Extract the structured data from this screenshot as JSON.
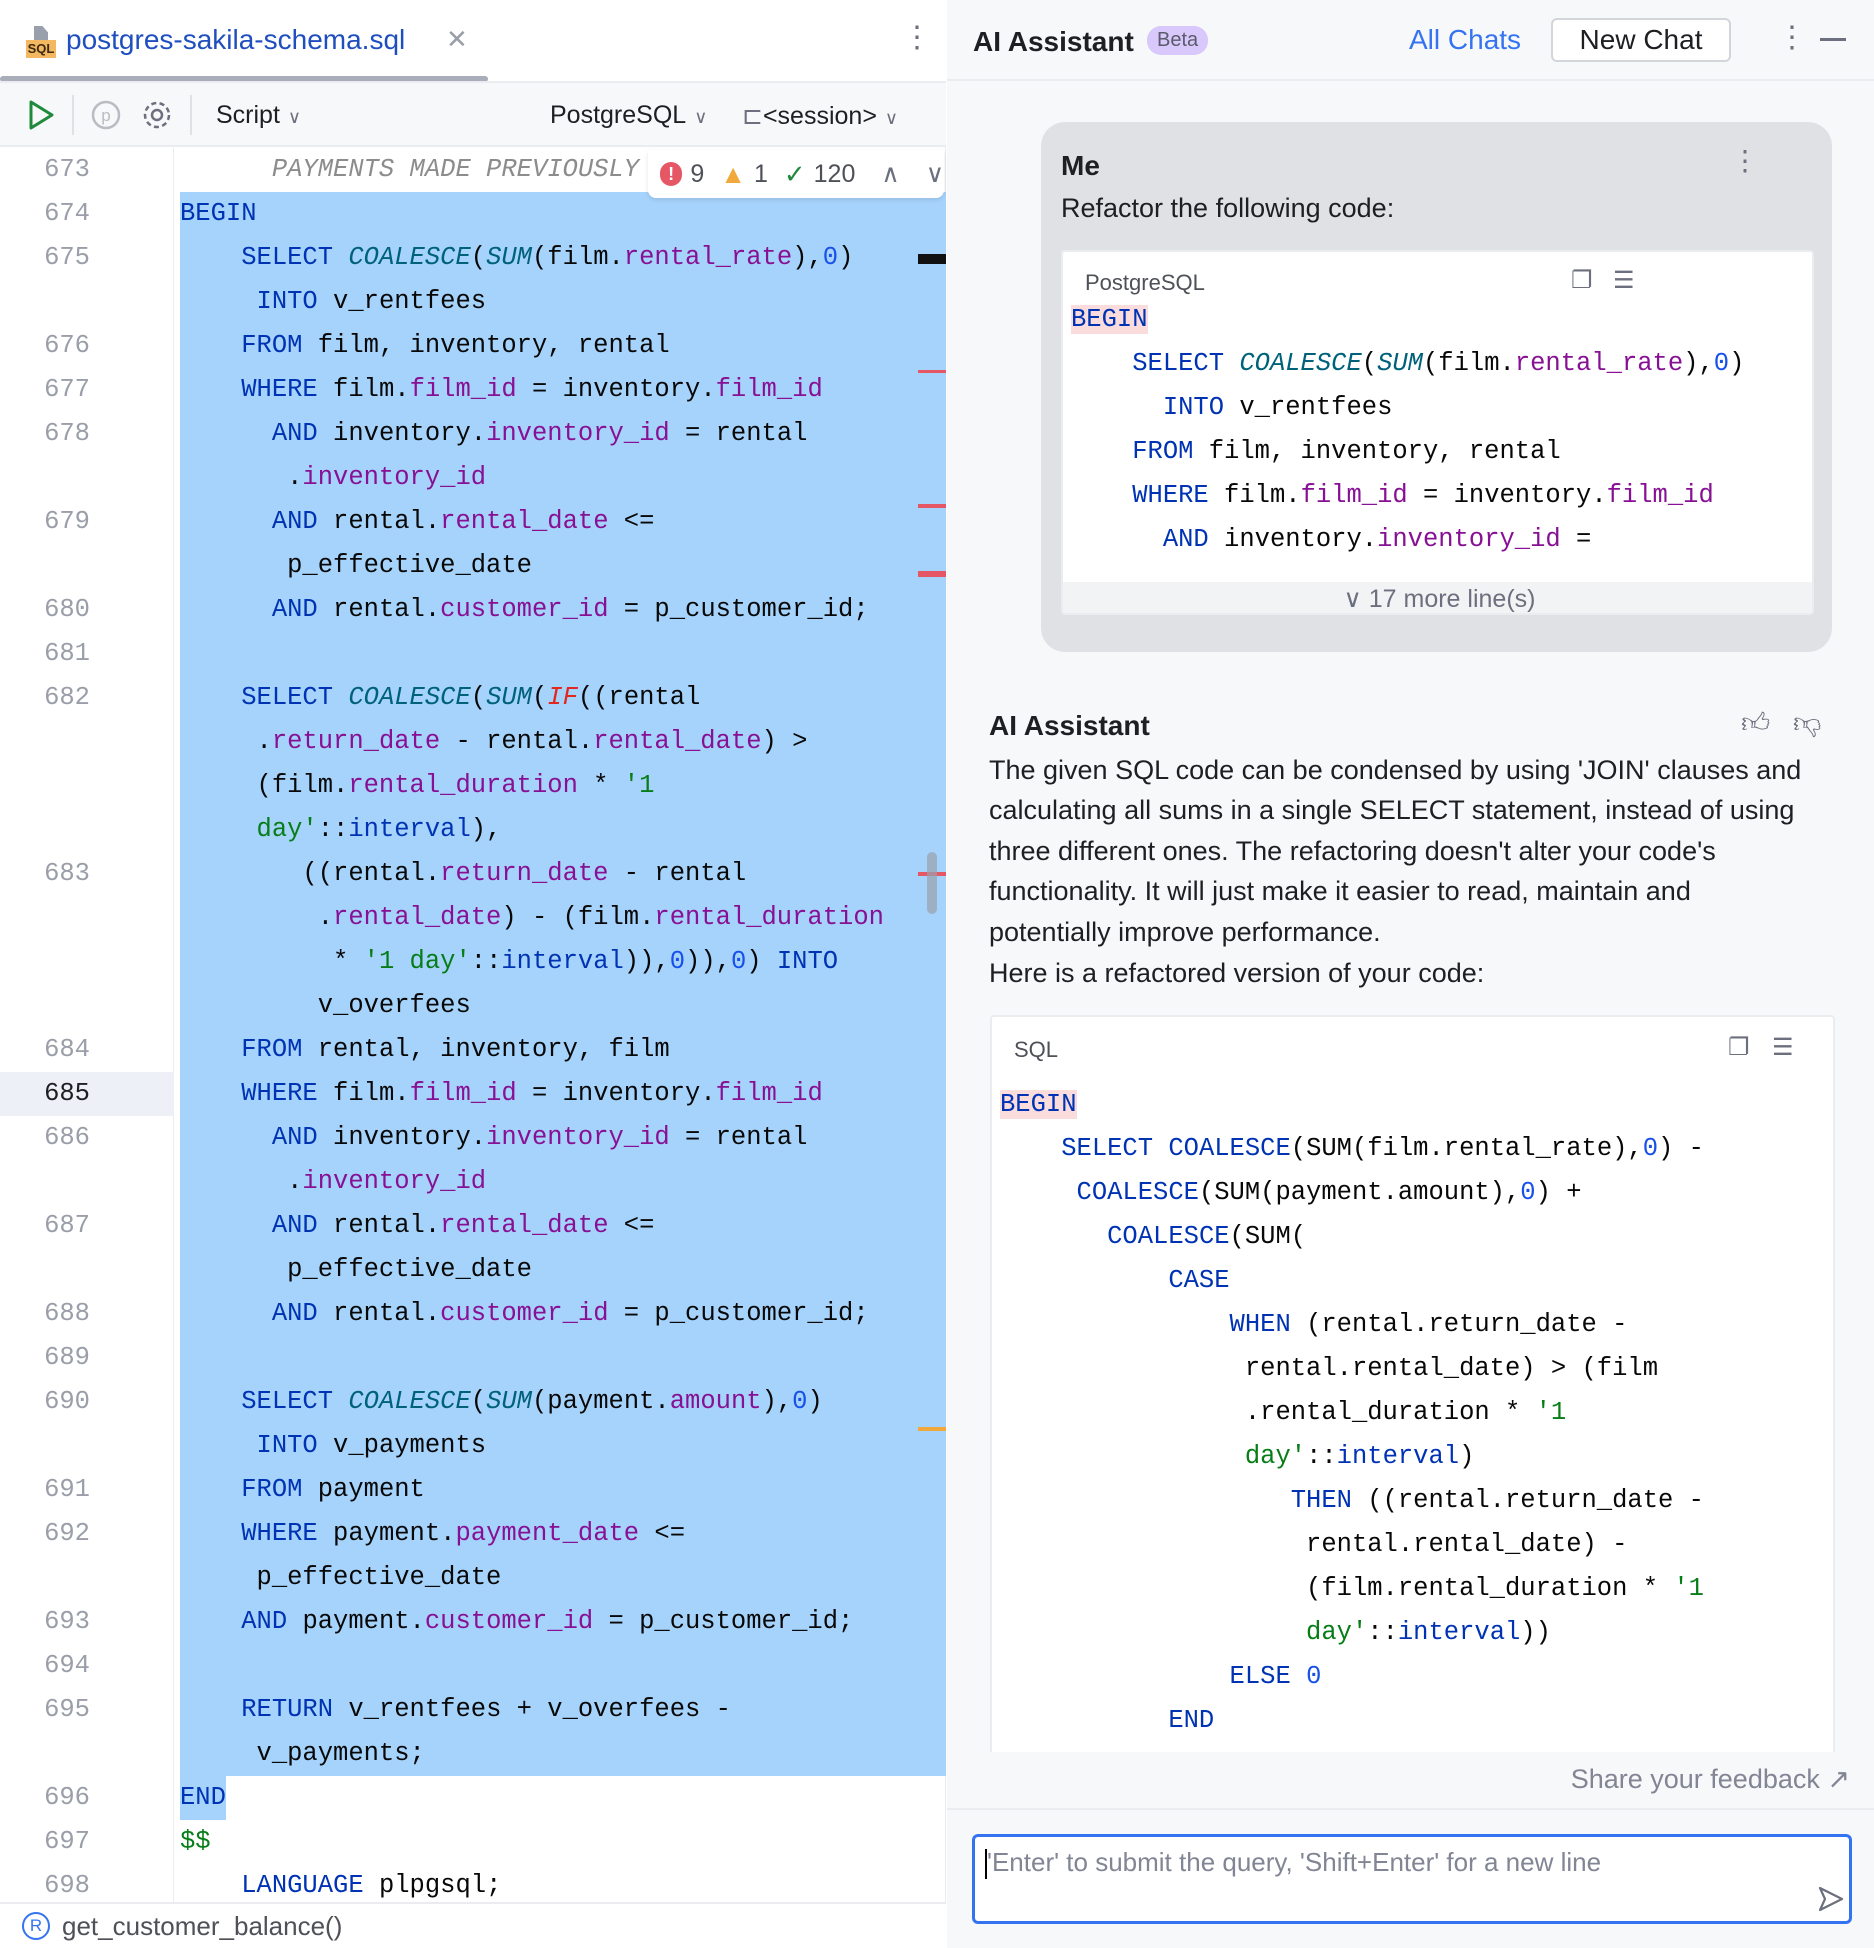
{
  "editor": {
    "tab_title": "postgres-sakila-schema.sql",
    "file_icon_text": "SQL",
    "toolbar": {
      "script_label": "Script",
      "dialect_label": "PostgreSQL",
      "session_label": "<session>"
    },
    "inspections": {
      "errors": "9",
      "warnings": "1",
      "ok": "120"
    },
    "status_function": "get_customer_balance()",
    "current_line": "685",
    "rows": [
      {
        "n": "673",
        "t": [
          [
            "c",
            "      PAYMENTS MADE PREVIOUSLY"
          ]
        ]
      },
      {
        "n": "674",
        "sel": "full",
        "t": [
          [
            "k",
            "BEGIN"
          ]
        ]
      },
      {
        "n": "675",
        "sel": "full",
        "t": [
          [
            "p",
            "    "
          ],
          [
            "k",
            "SELECT "
          ],
          [
            "f",
            "COALESCE"
          ],
          [
            "p",
            "("
          ],
          [
            "f",
            "SUM"
          ],
          [
            "p",
            "(film."
          ],
          [
            "d",
            "rental_rate"
          ],
          [
            "p",
            "),"
          ],
          [
            "n",
            "0"
          ],
          [
            "p",
            ")"
          ]
        ]
      },
      {
        "n": "",
        "sel": "full",
        "t": [
          [
            "p",
            "     "
          ],
          [
            "k",
            "INTO "
          ],
          [
            "p",
            "v_rentfees"
          ]
        ]
      },
      {
        "n": "676",
        "sel": "full",
        "t": [
          [
            "p",
            "    "
          ],
          [
            "k",
            "FROM "
          ],
          [
            "p",
            "film, inventory, rental"
          ]
        ]
      },
      {
        "n": "677",
        "sel": "full",
        "t": [
          [
            "p",
            "    "
          ],
          [
            "k",
            "WHERE "
          ],
          [
            "p",
            "film."
          ],
          [
            "d",
            "film_id"
          ],
          [
            "p",
            " = inventory."
          ],
          [
            "d",
            "film_id"
          ]
        ]
      },
      {
        "n": "678",
        "sel": "full",
        "t": [
          [
            "p",
            "      "
          ],
          [
            "k",
            "AND "
          ],
          [
            "p",
            "inventory."
          ],
          [
            "d",
            "inventory_id"
          ],
          [
            "p",
            " = rental"
          ]
        ]
      },
      {
        "n": "",
        "sel": "full",
        "t": [
          [
            "p",
            "       ."
          ],
          [
            "d",
            "inventory_id"
          ]
        ]
      },
      {
        "n": "679",
        "sel": "full",
        "t": [
          [
            "p",
            "      "
          ],
          [
            "k",
            "AND "
          ],
          [
            "p",
            "rental."
          ],
          [
            "d",
            "rental_date"
          ],
          [
            "p",
            " <="
          ]
        ]
      },
      {
        "n": "",
        "sel": "full",
        "t": [
          [
            "p",
            "       p_effective_date"
          ]
        ]
      },
      {
        "n": "680",
        "sel": "full",
        "t": [
          [
            "p",
            "      "
          ],
          [
            "k",
            "AND "
          ],
          [
            "p",
            "rental."
          ],
          [
            "d",
            "customer_id"
          ],
          [
            "p",
            " = p_customer_id;"
          ]
        ]
      },
      {
        "n": "681",
        "sel": "full",
        "t": []
      },
      {
        "n": "682",
        "sel": "full",
        "t": [
          [
            "p",
            "    "
          ],
          [
            "k",
            "SELECT "
          ],
          [
            "f",
            "COALESCE"
          ],
          [
            "p",
            "("
          ],
          [
            "f",
            "SUM"
          ],
          [
            "p",
            "("
          ],
          [
            "e",
            "IF"
          ],
          [
            "p",
            "((rental"
          ]
        ]
      },
      {
        "n": "",
        "sel": "full",
        "t": [
          [
            "p",
            "     ."
          ],
          [
            "d",
            "return_date"
          ],
          [
            "p",
            " - rental."
          ],
          [
            "d",
            "rental_date"
          ],
          [
            "p",
            ") >"
          ]
        ]
      },
      {
        "n": "",
        "sel": "full",
        "t": [
          [
            "p",
            "     (film."
          ],
          [
            "d",
            "rental_duration"
          ],
          [
            "p",
            " * "
          ],
          [
            "s",
            "'1"
          ]
        ]
      },
      {
        "n": "",
        "sel": "full",
        "t": [
          [
            "s",
            "     day'"
          ],
          [
            "p",
            "::"
          ],
          [
            "k",
            "interval"
          ],
          [
            "p",
            "),"
          ]
        ]
      },
      {
        "n": "683",
        "sel": "full",
        "t": [
          [
            "p",
            "        ((rental."
          ],
          [
            "d",
            "return_date"
          ],
          [
            "p",
            " - rental"
          ]
        ]
      },
      {
        "n": "",
        "sel": "full",
        "t": [
          [
            "p",
            "         ."
          ],
          [
            "d",
            "rental_date"
          ],
          [
            "p",
            ") - (film."
          ],
          [
            "d",
            "rental_duration"
          ]
        ]
      },
      {
        "n": "",
        "sel": "full",
        "t": [
          [
            "p",
            "          * "
          ],
          [
            "s",
            "'1 day'"
          ],
          [
            "p",
            "::"
          ],
          [
            "k",
            "interval"
          ],
          [
            "p",
            ")),"
          ],
          [
            "n",
            "0"
          ],
          [
            "p",
            ")),"
          ],
          [
            "n",
            "0"
          ],
          [
            "p",
            ") "
          ],
          [
            "k",
            "INTO"
          ]
        ]
      },
      {
        "n": "",
        "sel": "full",
        "t": [
          [
            "p",
            "         v_overfees"
          ]
        ]
      },
      {
        "n": "684",
        "sel": "full",
        "t": [
          [
            "p",
            "    "
          ],
          [
            "k",
            "FROM "
          ],
          [
            "p",
            "rental, inventory, film"
          ]
        ]
      },
      {
        "n": "685",
        "sel": "full",
        "t": [
          [
            "p",
            "    "
          ],
          [
            "k",
            "WHERE "
          ],
          [
            "p",
            "film."
          ],
          [
            "d",
            "film_id"
          ],
          [
            "p",
            " = inventory."
          ],
          [
            "d",
            "film_id"
          ]
        ]
      },
      {
        "n": "686",
        "sel": "full",
        "t": [
          [
            "p",
            "      "
          ],
          [
            "k",
            "AND "
          ],
          [
            "p",
            "inventory."
          ],
          [
            "d",
            "inventory_id"
          ],
          [
            "p",
            " = rental"
          ]
        ]
      },
      {
        "n": "",
        "sel": "full",
        "t": [
          [
            "p",
            "       ."
          ],
          [
            "d",
            "inventory_id"
          ]
        ]
      },
      {
        "n": "687",
        "sel": "full",
        "t": [
          [
            "p",
            "      "
          ],
          [
            "k",
            "AND "
          ],
          [
            "p",
            "rental."
          ],
          [
            "d",
            "rental_date"
          ],
          [
            "p",
            " <="
          ]
        ]
      },
      {
        "n": "",
        "sel": "full",
        "t": [
          [
            "p",
            "       p_effective_date"
          ]
        ]
      },
      {
        "n": "688",
        "sel": "full",
        "t": [
          [
            "p",
            "      "
          ],
          [
            "k",
            "AND "
          ],
          [
            "p",
            "rental."
          ],
          [
            "d",
            "customer_id"
          ],
          [
            "p",
            " = p_customer_id;"
          ]
        ]
      },
      {
        "n": "689",
        "sel": "full",
        "t": []
      },
      {
        "n": "690",
        "sel": "full",
        "t": [
          [
            "p",
            "    "
          ],
          [
            "k",
            "SELECT "
          ],
          [
            "f",
            "COALESCE"
          ],
          [
            "p",
            "("
          ],
          [
            "f",
            "SUM"
          ],
          [
            "p",
            "(payment."
          ],
          [
            "d",
            "amount"
          ],
          [
            "p",
            "),"
          ],
          [
            "n",
            "0"
          ],
          [
            "p",
            ")"
          ]
        ]
      },
      {
        "n": "",
        "sel": "full",
        "t": [
          [
            "p",
            "     "
          ],
          [
            "k",
            "INTO "
          ],
          [
            "p",
            "v_payments"
          ]
        ]
      },
      {
        "n": "691",
        "sel": "full",
        "t": [
          [
            "p",
            "    "
          ],
          [
            "k",
            "FROM "
          ],
          [
            "p",
            "payment"
          ]
        ]
      },
      {
        "n": "692",
        "sel": "full",
        "t": [
          [
            "p",
            "    "
          ],
          [
            "k",
            "WHERE "
          ],
          [
            "p",
            "payment."
          ],
          [
            "d",
            "payment_date"
          ],
          [
            "p",
            " <="
          ]
        ]
      },
      {
        "n": "",
        "sel": "full",
        "t": [
          [
            "p",
            "     p_effective_date"
          ]
        ]
      },
      {
        "n": "693",
        "sel": "full",
        "t": [
          [
            "p",
            "    "
          ],
          [
            "k",
            "AND "
          ],
          [
            "p",
            "payment."
          ],
          [
            "d",
            "customer_id"
          ],
          [
            "p",
            " = p_customer_id;"
          ]
        ]
      },
      {
        "n": "694",
        "sel": "full",
        "t": []
      },
      {
        "n": "695",
        "sel": "full",
        "t": [
          [
            "p",
            "    "
          ],
          [
            "k",
            "RETURN "
          ],
          [
            "p",
            "v_rentfees + v_overfees -"
          ]
        ]
      },
      {
        "n": "",
        "sel": "full",
        "t": [
          [
            "p",
            "     v_payments;"
          ]
        ]
      },
      {
        "n": "696",
        "sel": "part",
        "t": [
          [
            "k",
            "END"
          ]
        ]
      },
      {
        "n": "697",
        "t": [
          [
            "s",
            "$$"
          ]
        ]
      },
      {
        "n": "698",
        "t": [
          [
            "p",
            "    "
          ],
          [
            "k",
            "LANGUAGE "
          ],
          [
            "p",
            "plpgsql;"
          ]
        ]
      }
    ]
  },
  "assistant": {
    "title": "AI Assistant",
    "badge": "Beta",
    "all_chats": "All Chats",
    "new_chat": "New Chat",
    "user": {
      "name": "Me",
      "message": "Refactor the following code:",
      "code_lang": "PostgreSQL",
      "more_lines": "17 more line(s)",
      "rows": [
        [
          [
            "pk",
            "BEGIN"
          ]
        ],
        [
          [
            "p",
            "    "
          ],
          [
            "k",
            "SELECT "
          ],
          [
            "f",
            "COALESCE"
          ],
          [
            "p",
            "("
          ],
          [
            "f",
            "SUM"
          ],
          [
            "p",
            "(film."
          ],
          [
            "d",
            "rental_rate"
          ],
          [
            "p",
            "),"
          ],
          [
            "n",
            "0"
          ],
          [
            "p",
            ")"
          ]
        ],
        [
          [
            "p",
            "      "
          ],
          [
            "k",
            "INTO "
          ],
          [
            "p",
            "v_rentfees"
          ]
        ],
        [
          [
            "p",
            "    "
          ],
          [
            "k",
            "FROM "
          ],
          [
            "p",
            "film, inventory, rental"
          ]
        ],
        [
          [
            "p",
            "    "
          ],
          [
            "k",
            "WHERE "
          ],
          [
            "p",
            "film."
          ],
          [
            "d",
            "film_id"
          ],
          [
            "p",
            " = inventory."
          ],
          [
            "d",
            "film_id"
          ]
        ],
        [
          [
            "p",
            "      "
          ],
          [
            "k",
            "AND "
          ],
          [
            "p",
            "inventory."
          ],
          [
            "d",
            "inventory_id"
          ],
          [
            "p",
            " ="
          ]
        ]
      ]
    },
    "reply": {
      "name": "AI Assistant",
      "paragraph": "The given SQL code can be condensed by using 'JOIN' clauses and calculating all sums in a single SELECT statement, instead of using three different ones. The refactoring doesn't alter your code's functionality. It will just make it easier to read, maintain and potentially improve performance.",
      "lead": "Here is a refactored version of your code:",
      "code_lang": "SQL",
      "rows": [
        [
          [
            "pk",
            "BEGIN"
          ]
        ],
        [
          [
            "p",
            "    "
          ],
          [
            "k",
            "SELECT COALESCE"
          ],
          [
            "p",
            "(SUM(film.rental_rate),"
          ],
          [
            "n",
            "0"
          ],
          [
            "p",
            ") -"
          ]
        ],
        [
          [
            "p",
            "     "
          ],
          [
            "k",
            "COALESCE"
          ],
          [
            "p",
            "(SUM(payment.amount),"
          ],
          [
            "n",
            "0"
          ],
          [
            "p",
            ") +"
          ]
        ],
        [
          [
            "p",
            "       "
          ],
          [
            "k",
            "COALESCE"
          ],
          [
            "p",
            "(SUM("
          ]
        ],
        [
          [
            "p",
            "           "
          ],
          [
            "k",
            "CASE"
          ]
        ],
        [
          [
            "p",
            "               "
          ],
          [
            "k",
            "WHEN "
          ],
          [
            "p",
            "(rental.return_date -"
          ]
        ],
        [
          [
            "p",
            "                rental.rental_date) > (film"
          ]
        ],
        [
          [
            "p",
            "                .rental_duration * "
          ],
          [
            "s",
            "'1"
          ]
        ],
        [
          [
            "s",
            "                day'"
          ],
          [
            "p",
            "::"
          ],
          [
            "k",
            "interval"
          ],
          [
            "p",
            ")"
          ]
        ],
        [
          [
            "p",
            "                   "
          ],
          [
            "k",
            "THEN "
          ],
          [
            "p",
            "((rental.return_date -"
          ]
        ],
        [
          [
            "p",
            "                    rental.rental_date) -"
          ]
        ],
        [
          [
            "p",
            "                    (film.rental_duration * "
          ],
          [
            "s",
            "'1"
          ]
        ],
        [
          [
            "s",
            "                    day'"
          ],
          [
            "p",
            "::"
          ],
          [
            "k",
            "interval"
          ],
          [
            "p",
            "))"
          ]
        ],
        [
          [
            "p",
            "               "
          ],
          [
            "k",
            "ELSE "
          ],
          [
            "n",
            "0"
          ]
        ],
        [
          [
            "p",
            "           "
          ],
          [
            "k",
            "END"
          ]
        ]
      ]
    },
    "feedback": "Share your feedback ↗",
    "input_placeholder": "'Enter' to submit the query, 'Shift+Enter' for a new line"
  },
  "colors": {
    "accent": "#3574f0",
    "selection": "#a6d3fb",
    "keyword": "#0033b3",
    "field": "#871094",
    "string": "#067d17",
    "number": "#1750eb"
  }
}
